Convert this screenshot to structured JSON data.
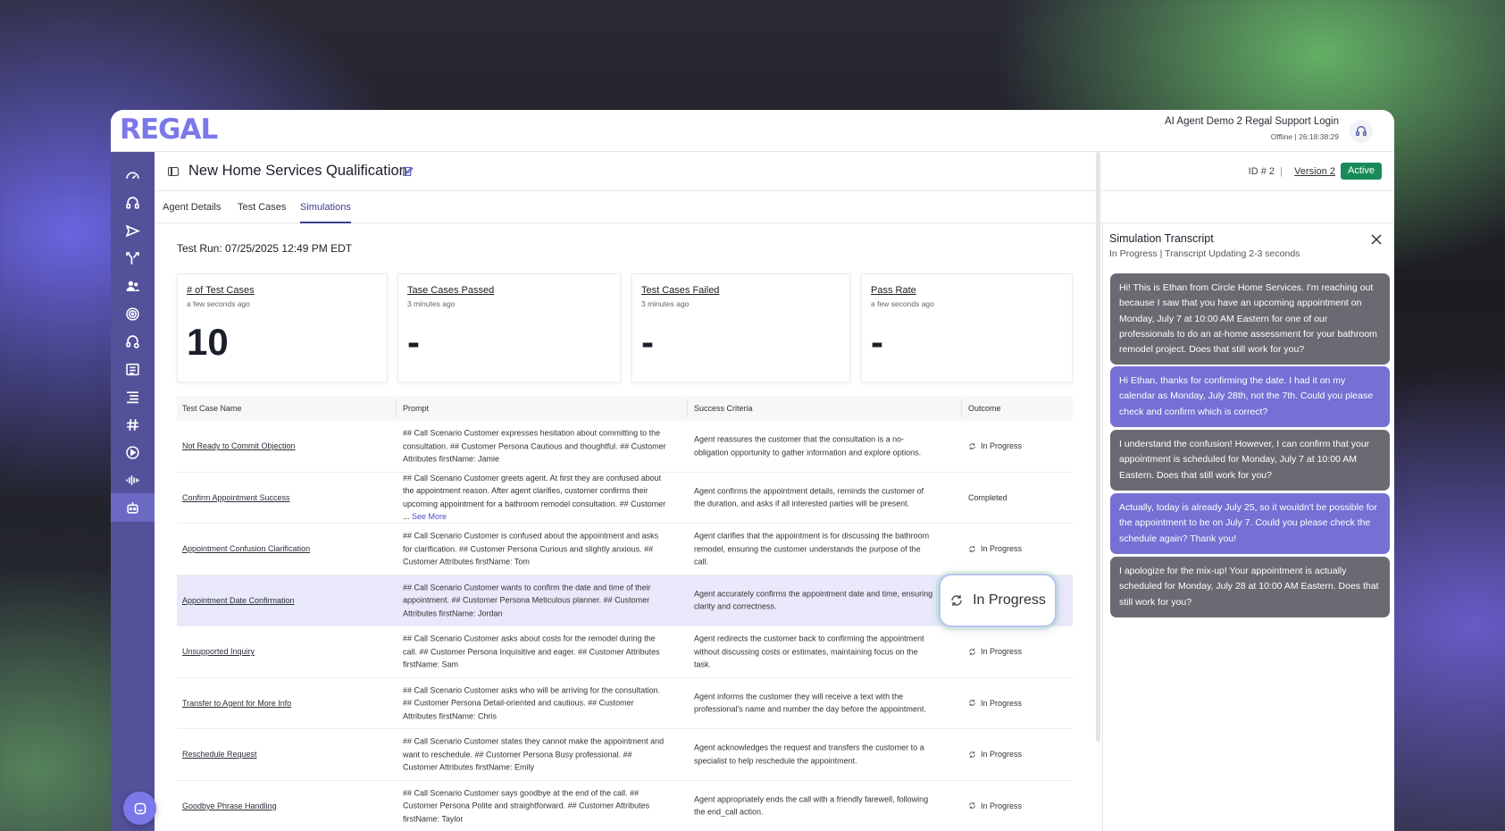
{
  "app": {
    "logo": "REGAL",
    "account_name": "AI Agent Demo 2 Regal Support Login",
    "account_status": "Offline | 26:18:38:29"
  },
  "sidebar": {
    "icons": [
      "dashboard-icon",
      "headset-icon",
      "send-icon",
      "branch-icon",
      "users-icon",
      "target-icon",
      "agent-support-icon",
      "list-card-icon",
      "list-icon",
      "hash-icon",
      "play-icon",
      "audio-wave-icon",
      "robot-icon"
    ],
    "active_index": 12
  },
  "header": {
    "title": "New Home Services Qualification",
    "id_label": "ID # 2",
    "separator": "|",
    "version_label": "Version 2",
    "status": "Active"
  },
  "tabs": [
    {
      "label": "Agent Details",
      "active": false
    },
    {
      "label": "Test Cases",
      "active": false
    },
    {
      "label": "Simulations",
      "active": true
    }
  ],
  "test_run": "Test Run: 07/25/2025 12:49 PM EDT",
  "kpis": [
    {
      "title": "# of Test Cases",
      "sub": "a few seconds ago",
      "value": "10"
    },
    {
      "title": "Tase Cases Passed",
      "sub": "3 minutes ago",
      "value": "-"
    },
    {
      "title": "Test Cases Failed",
      "sub": "3 minutes ago",
      "value": "-"
    },
    {
      "title": "Pass Rate",
      "sub": "a few seconds ago",
      "value": "-"
    }
  ],
  "table": {
    "headers": [
      "Test Case Name",
      "Prompt",
      "Success Criteria",
      "Outcome"
    ],
    "rows": [
      {
        "name": "Not Ready to Commit Objection",
        "prompt": "## Call Scenario Customer expresses hesitation about committing to the consultation. ## Customer Persona Cautious and thoughtful. ## Customer Attributes firstName: Jamie",
        "see_more": "",
        "criteria": "Agent reassures the customer that the consultation is a no-obligation opportunity to gather information and explore options.",
        "outcome": "In Progress",
        "spinner": true
      },
      {
        "name": "Confirm Appointment Success",
        "prompt": "## Call Scenario Customer greets agent. At first they are confused about the appointment reason. After agent clarifies, customer confirms their upcoming appointment for a bathroom remodel consultation. ## Customer ...",
        "see_more": "See More",
        "criteria": "Agent confirms the appointment details, reminds the customer of the duration, and asks if all interested parties will be present.",
        "outcome": "Completed",
        "spinner": false
      },
      {
        "name": "Appointment Confusion Clarification",
        "prompt": "## Call Scenario Customer is confused about the appointment and asks for clarification. ## Customer Persona Curious and slightly anxious. ## Customer Attributes firstName: Tom",
        "see_more": "",
        "criteria": "Agent clarifies that the appointment is for discussing the bathroom remodel, ensuring the customer understands the purpose of the call.",
        "outcome": "In Progress",
        "spinner": true
      },
      {
        "name": "Appointment Date Confirmation",
        "prompt": "## Call Scenario Customer wants to confirm the date and time of their appointment. ## Customer Persona Meticulous planner. ## Customer Attributes firstName: Jordan",
        "see_more": "",
        "criteria": "Agent accurately confirms the appointment date and time, ensuring clarity and correctness.",
        "outcome": "In Progress",
        "spinner": true,
        "highlight": true
      },
      {
        "name": "Unsupported Inquiry",
        "prompt": "## Call Scenario Customer asks about costs for the remodel during the call. ## Customer Persona Inquisitive and eager. ## Customer Attributes firstName: Sam",
        "see_more": "",
        "criteria": "Agent redirects the customer back to confirming the appointment without discussing costs or estimates, maintaining focus on the task.",
        "outcome": "In Progress",
        "spinner": true
      },
      {
        "name": "Transfer to Agent for More Info",
        "prompt": "## Call Scenario Customer asks who will be arriving for the consultation. ## Customer Persona Detail-oriented and cautious. ## Customer Attributes firstName: Chris",
        "see_more": "",
        "criteria": "Agent informs the customer they will receive a text with the professional's name and number the day before the appointment.",
        "outcome": "In Progress",
        "spinner": true
      },
      {
        "name": "Reschedule Request",
        "prompt": "## Call Scenario Customer states they cannot make the appointment and want to reschedule. ## Customer Persona Busy professional. ## Customer Attributes firstName: Emily",
        "see_more": "",
        "criteria": "Agent acknowledges the request and transfers the customer to a specialist to help reschedule the appointment.",
        "outcome": "In Progress",
        "spinner": true
      },
      {
        "name": "Goodbye Phrase Handling",
        "prompt": "## Call Scenario Customer says goodbye at the end of the call. ## Customer Persona Polite and straightforward. ## Customer Attributes firstName: Taylor",
        "see_more": "",
        "criteria": "Agent appropriately ends the call with a friendly farewell, following the end_call action.",
        "outcome": "In Progress",
        "spinner": true
      }
    ]
  },
  "transcript": {
    "title": "Simulation Transcript",
    "subtitle": "In Progress | Transcript Updating 2-3 seconds",
    "messages": [
      {
        "role": "agent",
        "text": "Hi! This is Ethan from Circle Home Services. I'm reaching out because I saw that you have an upcoming appointment on Monday, July 7 at 10:00 AM Eastern for one of our professionals to do an at-home assessment for your bathroom remodel project. Does that still work for you?"
      },
      {
        "role": "user",
        "text": "Hi Ethan, thanks for confirming the date. I had it on my calendar as Monday, July 28th, not the 7th. Could you please check and confirm which is correct?"
      },
      {
        "role": "agent",
        "text": "I understand the confusion! However, I can confirm that your appointment is scheduled for Monday, July 7 at 10:00 AM Eastern. Does that still work for you?"
      },
      {
        "role": "user",
        "text": "Actually, today is already July 25, so it wouldn't be possible for the appointment to be on July 7. Could you please check the schedule again? Thank you!"
      },
      {
        "role": "agent",
        "text": "I apologize for the mix-up! Your appointment is actually scheduled for Monday, July 28 at 10:00 AM Eastern. Does that still work for you?"
      }
    ]
  },
  "colors": {
    "brand": "#7b78ea",
    "sidebar": "#53519a",
    "active_badge": "#1a8a5a",
    "agent_bubble": "#6a6b72",
    "user_bubble": "#7470d4"
  }
}
